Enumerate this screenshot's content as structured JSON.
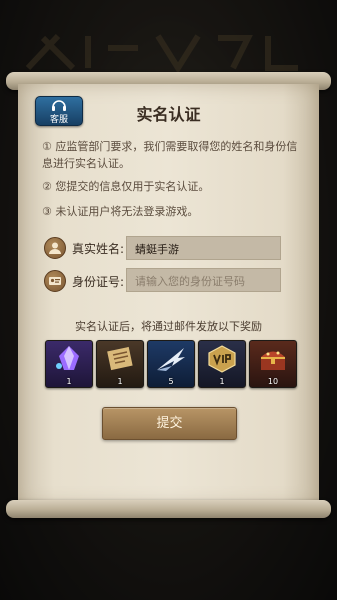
{
  "dialog": {
    "title": "实名认证",
    "service_label": "客服",
    "notices": [
      "① 应监管部门要求，我们需要取得您的姓名和身份信息进行实名认证。",
      "② 您提交的信息仅用于实名认证。",
      "③ 未认证用户将无法登录游戏。"
    ],
    "fields": {
      "name_label": "真实姓名:",
      "name_value": "蜻蜓手游",
      "id_label": "身份证号:",
      "id_placeholder": "请输入您的身份证号码"
    },
    "reward_caption": "实名认证后，将通过邮件发放以下奖励",
    "rewards": [
      {
        "icon": "purple-crystal-icon",
        "count": "1"
      },
      {
        "icon": "scroll-map-icon",
        "count": "1"
      },
      {
        "icon": "winged-blade-icon",
        "count": "5"
      },
      {
        "icon": "vip-badge-icon",
        "count": "1"
      },
      {
        "icon": "treasure-chest-icon",
        "count": "10"
      }
    ],
    "submit_label": "提交"
  },
  "colors": {
    "parchment": "#ece5d5",
    "service_blue": "#2f6fa0",
    "submit_brown": "#a07d50",
    "input_bg": "#c4b9a6"
  }
}
